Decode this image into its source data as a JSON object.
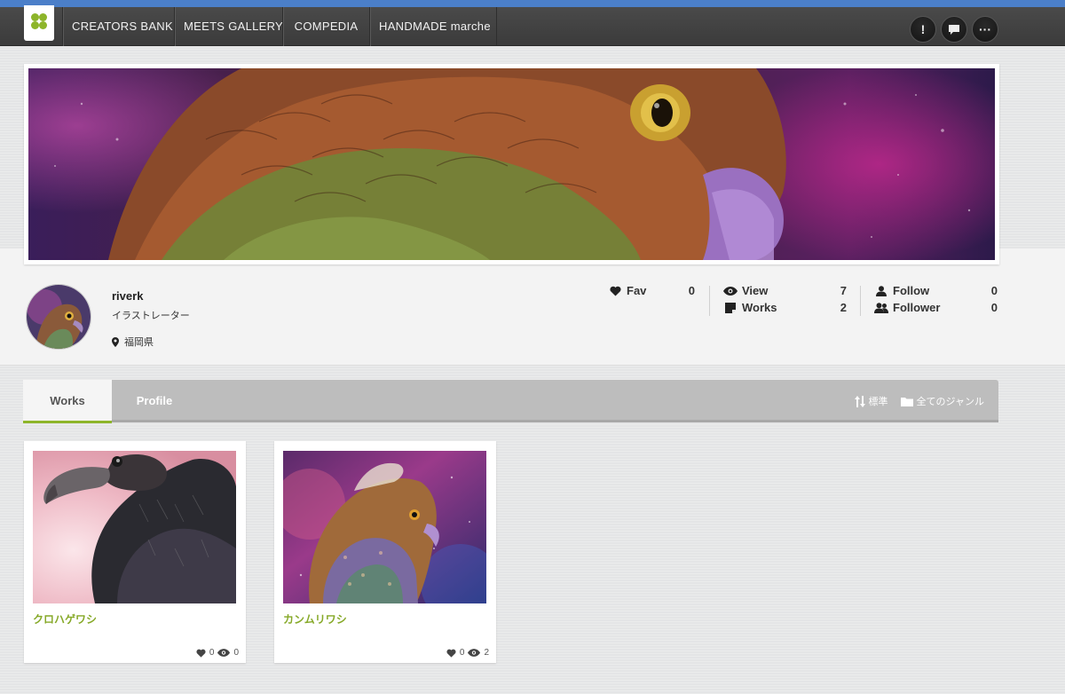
{
  "nav": {
    "items": [
      {
        "label": "CREATORS BANK"
      },
      {
        "label": "MEETS GALLERY"
      },
      {
        "label": "COMPEDIA"
      },
      {
        "label": "HANDMADE marche"
      }
    ],
    "icons": [
      "alert-icon",
      "message-icon",
      "more-icon"
    ],
    "alert_glyph": "!",
    "more_glyph": "···"
  },
  "profile": {
    "name": "riverk",
    "role": "イラストレーター",
    "location": "福岡県"
  },
  "stats": {
    "fav": {
      "label": "Fav",
      "value": "0"
    },
    "view": {
      "label": "View",
      "value": "7"
    },
    "works": {
      "label": "Works",
      "value": "2"
    },
    "follow": {
      "label": "Follow",
      "value": "0"
    },
    "follower": {
      "label": "Follower",
      "value": "0"
    }
  },
  "tabs": {
    "works": "Works",
    "profile": "Profile",
    "sort": "標準",
    "genre": "全てのジャンル"
  },
  "works": [
    {
      "title": "クロハゲワシ",
      "fav": "0",
      "views": "0"
    },
    {
      "title": "カンムリワシ",
      "fav": "0",
      "views": "2"
    }
  ],
  "colors": {
    "accent_green": "#8db52a",
    "title_green": "#86a928",
    "top_bar_blue": "#4b7fc9",
    "nav_dark": "#424242",
    "tab_bar_gray": "#bdbdbd"
  }
}
